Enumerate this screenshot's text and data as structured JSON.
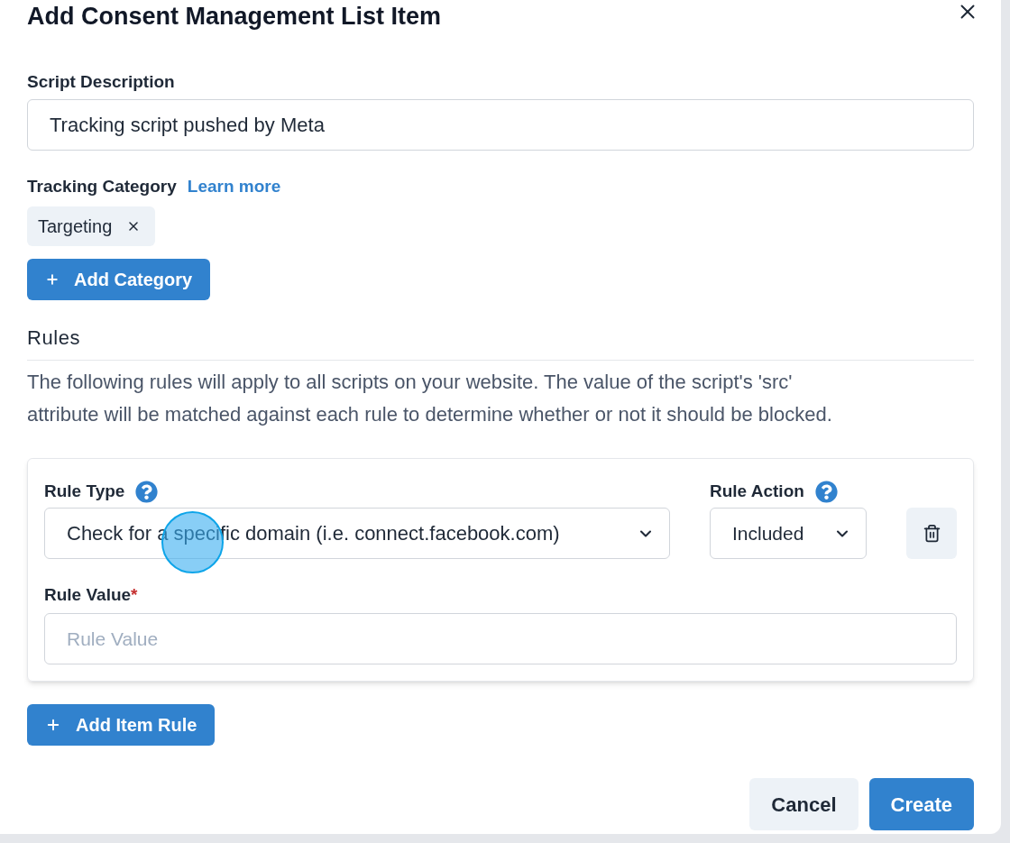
{
  "dialog": {
    "title": "Add Consent Management List Item"
  },
  "description": {
    "label": "Script Description",
    "value": "Tracking script pushed by Meta"
  },
  "category": {
    "label": "Tracking Category",
    "link": "Learn more",
    "chips": [
      {
        "label": "Targeting"
      }
    ],
    "add_button": "Add Category"
  },
  "rules": {
    "heading": "Rules",
    "text": "The following rules will apply to all scripts on your website. The value of the script's 'src' attribute will be matched against each rule to determine whether or not it should be blocked.",
    "items": [
      {
        "type_label": "Rule Type",
        "type_value": "Check for a specific domain (i.e. connect.facebook.com)",
        "action_label": "Rule Action",
        "action_value": "Included",
        "value_label": "Rule Value",
        "required_mark": "*",
        "value_placeholder": "Rule Value"
      }
    ],
    "add_button": "Add Item Rule"
  },
  "footer": {
    "cancel": "Cancel",
    "create": "Create"
  }
}
